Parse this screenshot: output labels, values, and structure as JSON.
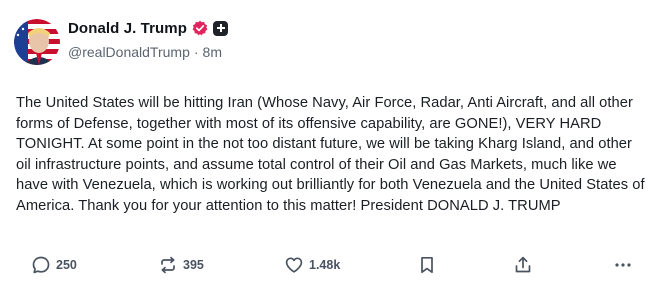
{
  "post": {
    "author": {
      "display_name": "Donald J. Trump",
      "handle": "@realDonaldTrump",
      "separator": "·",
      "time": "8m"
    },
    "text": "The United States will be hitting Iran (Whose Navy, Air Force, Radar, Anti Aircraft, and all other forms of Defense, together with most of its offensive capability, are GONE!), VERY HARD TONIGHT. At some point in the not too distant  future, we will be taking Kharg Island, and other oil infrastructure points, and assume total control of their Oil and Gas Markets, much like we have with Venezuela, which is working out brilliantly for both Venezuela and the United States of America. Thank you for your attention to this matter! President DONALD J. TRUMP",
    "actions": {
      "reply_count": "250",
      "repost_count": "395",
      "like_count": "1.48k"
    },
    "icons": {
      "avatar": "avatar-image",
      "verified": "verified-badge-icon",
      "plus": "plus-badge-icon",
      "reply": "speech-bubble-icon",
      "repost": "repost-arrows-icon",
      "like": "heart-icon",
      "bookmark": "bookmark-icon",
      "share": "share-upload-icon",
      "more": "more-dots-icon"
    },
    "colors": {
      "verified_badge": "#e0245e",
      "text": "#1b1f24",
      "muted": "#5b6470"
    }
  }
}
